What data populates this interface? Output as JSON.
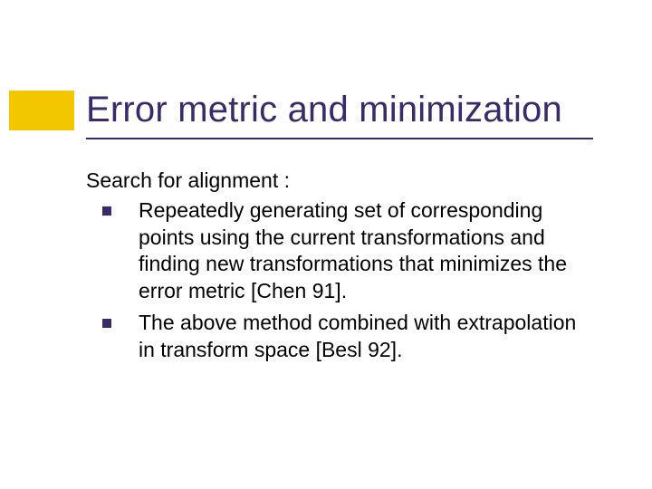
{
  "title": "Error metric and minimization",
  "lead": "Search for alignment :",
  "bullets": [
    "Repeatedly generating set of corresponding points using the current transformations and finding new transformations that minimizes the error metric [Chen 91].",
    "The above method combined with extrapolation in transform space [Besl 92]."
  ]
}
